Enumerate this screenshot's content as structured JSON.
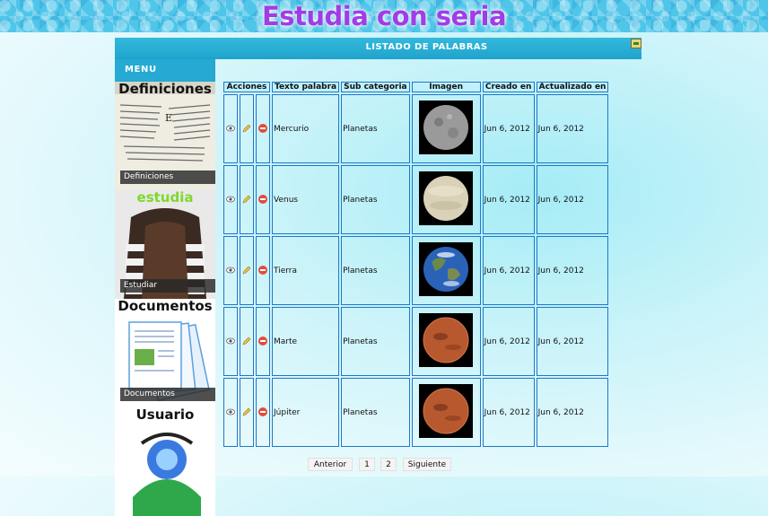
{
  "site": {
    "title": "Estudia con seria"
  },
  "header": {
    "title": "LISTADO DE PALABRAS",
    "exit_icon": "exit-icon"
  },
  "menu": {
    "title": "MENU",
    "items": [
      {
        "label": "Definiciones",
        "caption": "Definiciones",
        "icon": "definiciones-image"
      },
      {
        "label": "Estudiar",
        "caption": "estudia",
        "icon": "estudiar-image"
      },
      {
        "label": "Documentos",
        "caption": "Documentos",
        "icon": "documentos-image"
      },
      {
        "label": "Usuario",
        "caption": "Usuario",
        "icon": "usuario-image"
      }
    ]
  },
  "table": {
    "headers": [
      "Acciones",
      "Texto palabra",
      "Sub categoria",
      "Imagen",
      "Creado en",
      "Actualizado en"
    ],
    "rows": [
      {
        "word": "Mercurio",
        "sub": "Planetas",
        "image": "mercury",
        "created": "Jun 6, 2012",
        "updated": "Jun 6, 2012"
      },
      {
        "word": "Venus",
        "sub": "Planetas",
        "image": "venus",
        "created": "Jun 6, 2012",
        "updated": "Jun 6, 2012"
      },
      {
        "word": "Tierra",
        "sub": "Planetas",
        "image": "earth",
        "created": "Jun 6, 2012",
        "updated": "Jun 6, 2012"
      },
      {
        "word": "Marte",
        "sub": "Planetas",
        "image": "mars",
        "created": "Jun 6, 2012",
        "updated": "Jun 6, 2012"
      },
      {
        "word": "Júpiter",
        "sub": "Planetas",
        "image": "mars",
        "created": "Jun 6, 2012",
        "updated": "Jun 6, 2012"
      }
    ]
  },
  "pagination": {
    "prev": "Anterior",
    "pages": [
      "1",
      "2"
    ],
    "next": "Siguiente"
  },
  "colors": {
    "title": "#a13ce6",
    "header": "#26a9d3",
    "border": "#1e78c8"
  }
}
